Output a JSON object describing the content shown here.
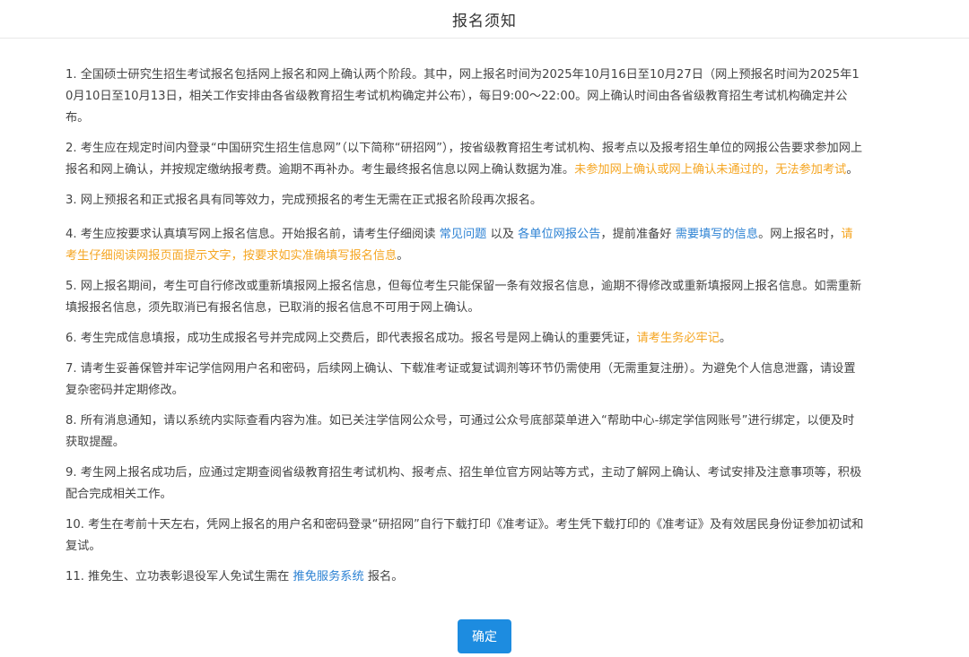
{
  "dialog": {
    "title": "报名须知",
    "confirm_label": "确定"
  },
  "items": [
    {
      "t1": "1. 全国硕士研究生招生考试报名包括网上报名和网上确认两个阶段。其中，网上报名时间为2025年10月16日至10月27日（网上预报名时间为2025年10月10日至10月13日，相关工作安排由各省级教育招生考试机构确定并公布），每日9:00～22:00。网上确认时间由各省级教育招生考试机构确定并公布。"
    },
    {
      "t1": "2. 考生应在规定时间内登录“中国研究生招生信息网”（以下简称“研招网”），按省级教育招生考试机构、报考点以及报考招生单位的网报公告要求参加网上报名和网上确认，并按规定缴纳报考费。逾期不再补办。考生最终报名信息以网上确认数据为准。",
      "warn1": "未参加网上确认或网上确认未通过的，无法参加考试",
      "t2": "。"
    },
    {
      "t1": "3. 网上预报名和正式报名具有同等效力，完成预报名的考生无需在正式报名阶段再次报名。"
    },
    {
      "t1": "4. 考生应按要求认真填写网上报名信息。开始报名前，请考生仔细阅读 ",
      "link1": "常见问题",
      "t2": " 以及 ",
      "link2": "各单位网报公告",
      "t3": "，提前准备好 ",
      "link3": "需要填写的信息",
      "t4": "。网上报名时，",
      "warn1": "请考生仔细阅读网报页面提示文字，按要求如实准确填写报名信息",
      "t5": "。"
    },
    {
      "t1": "5. 网上报名期间，考生可自行修改或重新填报网上报名信息，但每位考生只能保留一条有效报名信息，逾期不得修改或重新填报网上报名信息。如需重新填报报名信息，须先取消已有报名信息，已取消的报名信息不可用于网上确认。"
    },
    {
      "t1": "6. 考生完成信息填报，成功生成报名号并完成网上交费后，即代表报名成功。报名号是网上确认的重要凭证，",
      "warn1": "请考生务必牢记",
      "t2": "。"
    },
    {
      "t1": "7. 请考生妥善保管并牢记学信网用户名和密码，后续网上确认、下载准考证或复试调剂等环节仍需使用（无需重复注册）。为避免个人信息泄露，请设置复杂密码并定期修改。"
    },
    {
      "t1": "8. 所有消息通知，请以系统内实际查看内容为准。如已关注学信网公众号，可通过公众号底部菜单进入“帮助中心-绑定学信网账号”进行绑定，以便及时获取提醒。"
    },
    {
      "t1": "9. 考生网上报名成功后，应通过定期查阅省级教育招生考试机构、报考点、招生单位官方网站等方式，主动了解网上确认、考试安排及注意事项等，积极配合完成相关工作。"
    },
    {
      "t1": "10. 考生在考前十天左右，凭网上报名的用户名和密码登录“研招网”自行下载打印《准考证》。考生凭下载打印的《准考证》及有效居民身份证参加初试和复试。"
    },
    {
      "t1": "11. 推免生、立功表彰退役军人免试生需在 ",
      "link1": "推免服务系统",
      "t2": " 报名。"
    }
  ],
  "colors": {
    "link": "#2d82d3",
    "warn": "#f5a623",
    "button": "#1d8ce0",
    "text": "#444444"
  }
}
